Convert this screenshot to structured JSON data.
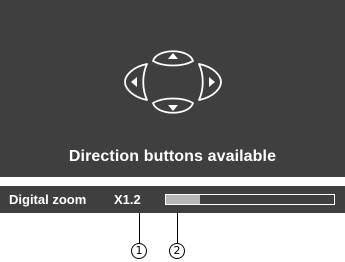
{
  "osd": {
    "message": "Direction buttons available",
    "dpad_icon": "direction-pad-icon"
  },
  "zoom": {
    "label": "Digital zoom",
    "value": "X1.2",
    "level_fraction": 0.2
  },
  "callouts": [
    "1",
    "2"
  ],
  "colors": {
    "panel": "#3f3f3f",
    "text": "#ffffff",
    "fill": "#b7b7b7"
  }
}
